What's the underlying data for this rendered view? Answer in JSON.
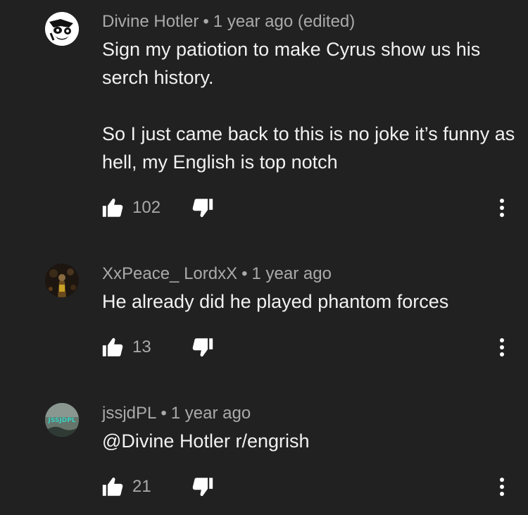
{
  "comments": [
    {
      "author": "Divine Hotler",
      "separator": "•",
      "time": "1 year ago (edited)",
      "paragraphs": [
        "Sign my patiotion to make Cyrus show us his serch history.",
        "So I just came back to this is no joke it’s funny as hell, my English is top notch"
      ],
      "likes": "102",
      "avatar_icon": "meme-face-icon"
    },
    {
      "author": "XxPeace_ LordxX",
      "separator": "•",
      "time": "1 year ago",
      "paragraphs": [
        "He already did he played phantom forces"
      ],
      "likes": "13",
      "avatar_icon": "photo-avatar"
    },
    {
      "author": "jssjdPL",
      "separator": "•",
      "time": "1 year ago",
      "paragraphs": [
        "@Divine Hotler r/engrish"
      ],
      "likes": "21",
      "avatar_icon": "jssjdpl-logo-avatar",
      "avatar_text": "JSSJDPL"
    }
  ],
  "colors": {
    "background": "#212121",
    "meta_text": "#aaaaaa",
    "body_text": "#f1f1f1",
    "icon": "#ffffff"
  }
}
